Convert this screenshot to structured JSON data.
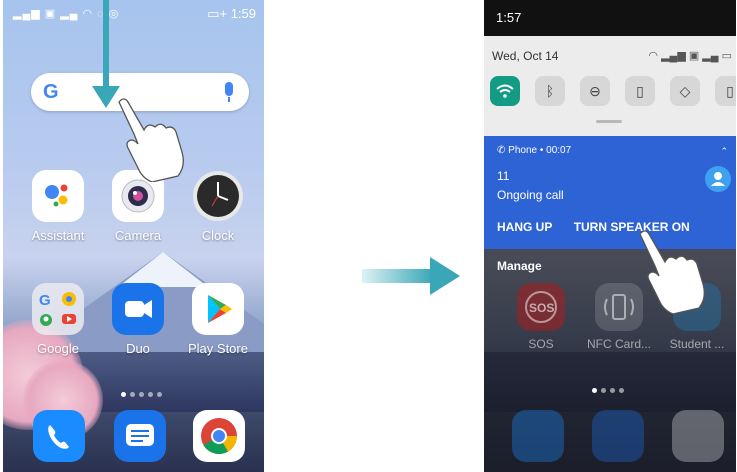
{
  "left_phone": {
    "status_icons": "▂▄▆ ▣ ▂▄ ◠ ◌ ◎",
    "battery": "▭+",
    "time": "1:59",
    "search": {
      "logo": "G"
    },
    "apps": [
      {
        "label": "Assistant",
        "icon": "google-assistant-icon"
      },
      {
        "label": "Camera",
        "icon": "camera-icon"
      },
      {
        "label": "Clock",
        "icon": "clock-icon"
      },
      {
        "label": "Google",
        "icon": "google-folder-icon"
      },
      {
        "label": "Duo",
        "icon": "duo-icon"
      },
      {
        "label": "Play Store",
        "icon": "play-store-icon"
      }
    ],
    "dock": [
      "phone-icon",
      "messages-icon",
      "chrome-icon"
    ]
  },
  "right_phone": {
    "time": "1:57",
    "date": "Wed, Oct 14",
    "sys_icons": "◠ ▂▄▆ ▣ ▂▄ ▭",
    "quick_settings": [
      "wifi-icon",
      "bluetooth-icon",
      "do-not-disturb-icon",
      "flashlight-icon",
      "auto-rotate-icon",
      "battery-saver-icon"
    ],
    "notification": {
      "app": "Phone • 00:07",
      "title": "11",
      "text": "Ongoing call",
      "actions": [
        "HANG UP",
        "TURN SPEAKER ON"
      ]
    },
    "manage_label": "Manage",
    "apps": [
      {
        "label": "SOS",
        "icon": "sos-icon"
      },
      {
        "label": "NFC Card...",
        "icon": "nfc-card-icon"
      },
      {
        "label": "Student ...",
        "icon": "student-icon"
      }
    ]
  },
  "colors": {
    "accent": "#3aa7b8",
    "notification_bg": "#2e63d6",
    "wifi_tile": "#139c83"
  }
}
